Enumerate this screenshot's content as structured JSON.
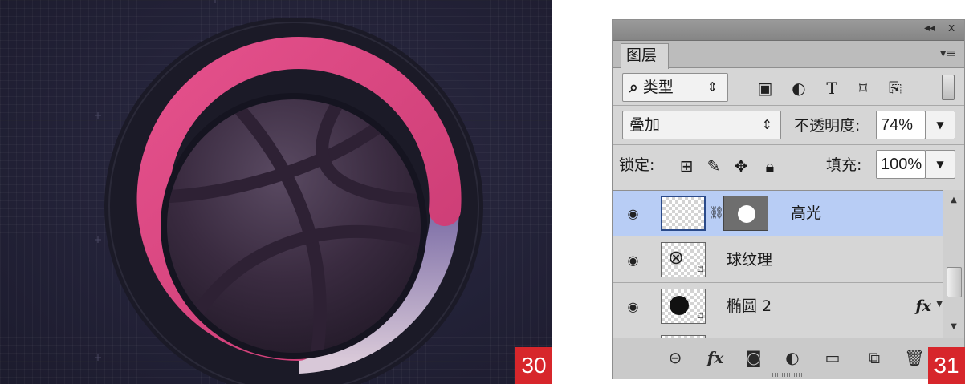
{
  "left_figure": {
    "badge": "30",
    "colors": {
      "background": "#25243a",
      "ring_track": "#1a1926",
      "progress_ring": "#de4a82",
      "ring_tail": "#9c8fb8",
      "ball": "#3b2c41"
    }
  },
  "layers_panel": {
    "titlebar": {
      "collapse_icon": "double-chevron-icon",
      "close_label": "x"
    },
    "tab_label": "图层",
    "panel_menu_icon": "panel-menu-icon",
    "filter": {
      "kind_label": "类型",
      "kind_icon": "search-icon",
      "icons": [
        "image-filter-icon",
        "adjustment-filter-icon",
        "type-filter-icon",
        "shape-filter-icon",
        "smart-object-filter-icon"
      ]
    },
    "blend_mode": "叠加",
    "opacity_label": "不透明度:",
    "opacity_value": "74%",
    "lock_label": "锁定:",
    "lock_icons": [
      "lock-transparent-icon",
      "lock-brush-icon",
      "lock-move-icon",
      "lock-all-icon"
    ],
    "fill_label": "填充:",
    "fill_value": "100%",
    "layers": [
      {
        "name": "高光",
        "selected": true,
        "has_mask": true,
        "fx": ""
      },
      {
        "name": "球纹理",
        "selected": false,
        "has_mask": false,
        "fx": ""
      },
      {
        "name": "椭圆 2",
        "selected": false,
        "has_mask": false,
        "fx": "fx"
      }
    ],
    "bottom_icons": [
      "link-icon",
      "fx-icon",
      "mask-icon",
      "adjustment-icon",
      "folder-icon",
      "new-layer-icon",
      "trash-icon"
    ],
    "bottom_fx_label": "fx",
    "badge": "31",
    "colors": {
      "selected_row": "#b8cdf5",
      "panel_bg": "#d6d6d6"
    }
  }
}
